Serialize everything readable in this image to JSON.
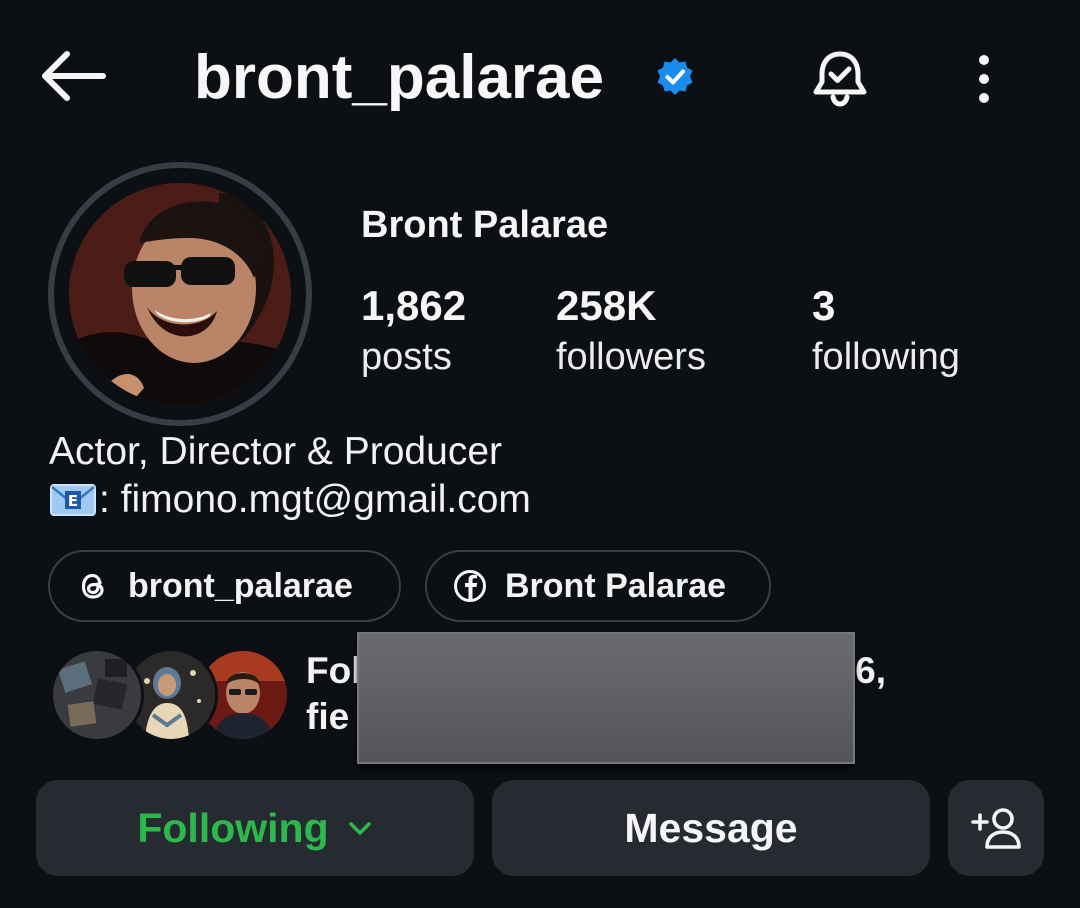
{
  "header": {
    "username": "bront_palarae",
    "verified_icon": "verified-badge-icon",
    "back_icon": "back-arrow-icon",
    "notification_icon": "bell-check-icon",
    "more_icon": "more-vertical-icon"
  },
  "profile": {
    "display_name": "Bront Palarae",
    "stats": [
      {
        "value": "1,862",
        "label": "posts"
      },
      {
        "value": "258K",
        "label": "followers"
      },
      {
        "value": "3",
        "label": "following"
      }
    ],
    "bio_line1": "Actor, Director & Producer",
    "bio_email": ": fimono.mgt@gmail.com",
    "bio_email_emoji": "📧"
  },
  "links": [
    {
      "icon": "threads-icon",
      "label": "bront_palarae"
    },
    {
      "icon": "facebook-icon",
      "label": "Bront Palarae"
    }
  ],
  "followed_by": {
    "line1_start": "Fol",
    "line1_end": "6,",
    "line2_start": "fie"
  },
  "actions": {
    "following_label": "Following",
    "message_label": "Message",
    "add_user_icon": "add-person-icon"
  },
  "colors": {
    "background": "#0c0f14",
    "following_green": "#2cb84a",
    "verified_blue": "#1a8cf0",
    "button_bg": "#262a31"
  }
}
